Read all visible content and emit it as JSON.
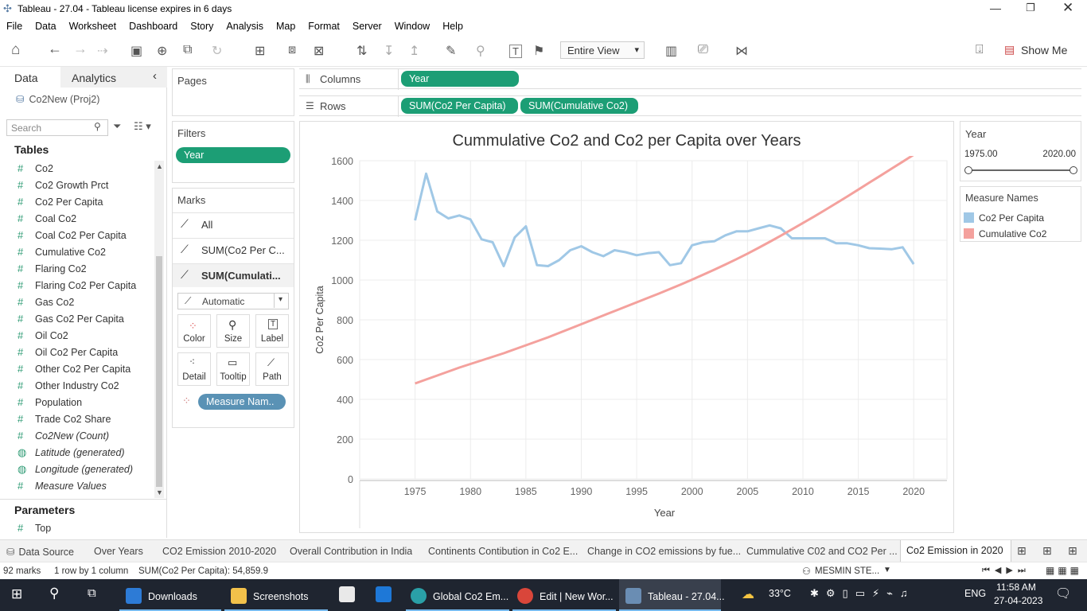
{
  "window": {
    "title": "Tableau - 27.04 - Tableau license expires in 6 days"
  },
  "menu": [
    "File",
    "Data",
    "Worksheet",
    "Dashboard",
    "Story",
    "Analysis",
    "Map",
    "Format",
    "Server",
    "Window",
    "Help"
  ],
  "toolbar": {
    "fit_dropdown": "Entire View",
    "show_me": "Show Me"
  },
  "left_pane": {
    "tab_data": "Data",
    "tab_analytics": "Analytics",
    "datasource": "Co2New (Proj2)",
    "search_placeholder": "Search",
    "tables_header": "Tables",
    "fields": [
      "Co2",
      "Co2 Growth Prct",
      "Co2 Per Capita",
      "Coal Co2",
      "Coal Co2 Per Capita",
      "Cumulative Co2",
      "Flaring Co2",
      "Flaring Co2 Per Capita",
      "Gas Co2",
      "Gas Co2 Per Capita",
      "Oil Co2",
      "Oil Co2 Per Capita",
      "Other Co2 Per Capita",
      "Other Industry Co2",
      "Population",
      "Trade Co2 Share"
    ],
    "italic_fields": [
      "Co2New (Count)",
      "Latitude (generated)",
      "Longitude (generated)",
      "Measure Values"
    ],
    "parameters_header": "Parameters",
    "parameters": [
      "Top"
    ]
  },
  "shelves": {
    "pages": "Pages",
    "filters": "Filters",
    "filter_pill": "Year",
    "columns": "Columns",
    "column_pill": "Year",
    "rows": "Rows",
    "row_pills": [
      "SUM(Co2 Per Capita)",
      "SUM(Cumulative Co2)"
    ]
  },
  "marks": {
    "header": "Marks",
    "all": "All",
    "row1": "SUM(Co2 Per C...",
    "row2": "SUM(Cumulati...",
    "mark_type": "Automatic",
    "cards": [
      "Color",
      "Size",
      "Label",
      "Detail",
      "Tooltip",
      "Path"
    ],
    "measure_pill": "Measure Nam.."
  },
  "year_filter": {
    "title": "Year",
    "min": "1975.00",
    "max": "2020.00"
  },
  "legend": {
    "title": "Measure Names",
    "items": [
      {
        "label": "Co2 Per Capita",
        "color": "#a0c8e6"
      },
      {
        "label": "Cumulative Co2",
        "color": "#f4a19d"
      }
    ]
  },
  "chart_data": {
    "type": "line",
    "title": "Cummulative Co2 and Co2 per Capita over Years",
    "xlabel": "Year",
    "ylabel": "Co2 Per Capita",
    "xlim": [
      1970,
      2023
    ],
    "ylim": [
      0,
      1600
    ],
    "x_ticks": [
      1975,
      1980,
      1985,
      1990,
      1995,
      2000,
      2005,
      2010,
      2015,
      2020
    ],
    "y_ticks": [
      0,
      200,
      400,
      600,
      800,
      1000,
      1200,
      1400,
      1600
    ],
    "grid": true,
    "x": [
      1975,
      1976,
      1977,
      1978,
      1979,
      1980,
      1981,
      1982,
      1983,
      1984,
      1985,
      1986,
      1987,
      1988,
      1989,
      1990,
      1991,
      1992,
      1993,
      1994,
      1995,
      1996,
      1997,
      1998,
      1999,
      2000,
      2001,
      2002,
      2003,
      2004,
      2005,
      2006,
      2007,
      2008,
      2009,
      2010,
      2011,
      2012,
      2013,
      2014,
      2015,
      2016,
      2017,
      2018,
      2019,
      2020
    ],
    "series": [
      {
        "name": "Co2 Per Capita",
        "color": "#a0c8e6",
        "values": [
          1300,
          1535,
          1345,
          1310,
          1325,
          1305,
          1205,
          1190,
          1070,
          1215,
          1270,
          1075,
          1070,
          1100,
          1150,
          1170,
          1140,
          1120,
          1150,
          1140,
          1125,
          1135,
          1140,
          1075,
          1085,
          1175,
          1190,
          1195,
          1225,
          1245,
          1245,
          1260,
          1275,
          1260,
          1210,
          1210,
          1210,
          1210,
          1185,
          1185,
          1175,
          1160,
          1158,
          1155,
          1165,
          1080
        ]
      },
      {
        "name": "Cumulative Co2",
        "color": "#f4a19d",
        "values": [
          480,
          500,
          520,
          540,
          560,
          578,
          596,
          614,
          632,
          652,
          672,
          692,
          712,
          734,
          756,
          778,
          800,
          822,
          844,
          866,
          888,
          910,
          932,
          955,
          978,
          1002,
          1027,
          1052,
          1078,
          1105,
          1133,
          1162,
          1192,
          1223,
          1255,
          1287,
          1319,
          1352,
          1386,
          1420,
          1455,
          1490,
          1525,
          1560,
          1595,
          1630
        ]
      }
    ]
  },
  "sheet_tabs": [
    "Data Source",
    "Over Years",
    "CO2 Emission 2010-2020",
    "Overall Contribution in India",
    "Continents Contibution in Co2 E...",
    "Change in CO2 emissions by fue...",
    "Cummulative C02 and CO2 Per ...",
    "Co2 Emission in 2020"
  ],
  "status": {
    "marks": "92 marks",
    "rows": "1 row by 1 column",
    "sum": "SUM(Co2 Per Capita): 54,859.9",
    "user": "MESMIN STE..."
  },
  "taskbar": {
    "apps": [
      "Downloads",
      "Screenshots",
      "Global Co2 Em...",
      "Edit | New Wor...",
      "Tableau - 27.04..."
    ],
    "weather": "33°C",
    "lang": "ENG",
    "time": "11:58 AM",
    "date": "27-04-2023"
  }
}
